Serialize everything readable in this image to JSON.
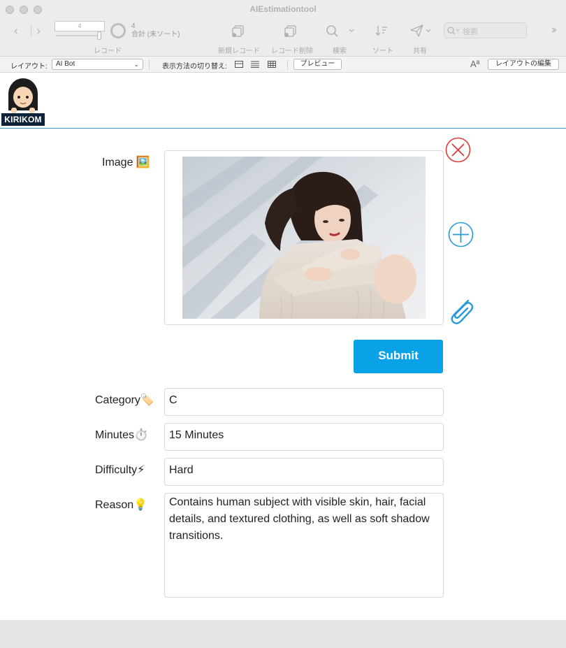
{
  "window": {
    "title": "AIEstimationtool"
  },
  "toolbar": {
    "record": {
      "current": "4",
      "total": "4",
      "total_label": "合計 (未ソート)",
      "caption": "レコード"
    },
    "new_record": "新規レコード",
    "delete_record": "レコード削除",
    "find": "検索",
    "sort": "ソート",
    "share": "共有",
    "search_placeholder": "検索",
    "icons": {
      "back": "chevron-left-icon",
      "forward": "chevron-right-icon",
      "new_record": "new-record-icon",
      "delete_record": "delete-record-icon",
      "find": "magnifier-icon",
      "sort": "sort-icon",
      "share": "paper-plane-icon",
      "overflow": "double-chevron-icon"
    }
  },
  "layout_bar": {
    "layout_label": "レイアウト:",
    "layout_value": "AI Bot",
    "view_label": "表示方法の切り替え:",
    "preview": "プレビュー",
    "edit_layout": "レイアウトの編集",
    "font_icon_text": "Aª"
  },
  "header": {
    "logo_text": "KIRIKOM"
  },
  "form": {
    "image_label": "Image 🖼️",
    "submit": "Submit",
    "fields": [
      {
        "label": "Category🏷️",
        "value": "C"
      },
      {
        "label": "Minutes⏱️",
        "value": "15 Minutes"
      },
      {
        "label": "Difficulty⚡",
        "value": "Hard"
      },
      {
        "label": "Reason💡",
        "value": "Contains human subject with visible skin, hair, facial details, and textured clothing, as well as soft shadow transitions."
      }
    ]
  },
  "colors": {
    "accent": "#0aa2e6",
    "delete": "#e03a3a",
    "add": "#2a9ad6",
    "header_line": "#3a95c9"
  }
}
